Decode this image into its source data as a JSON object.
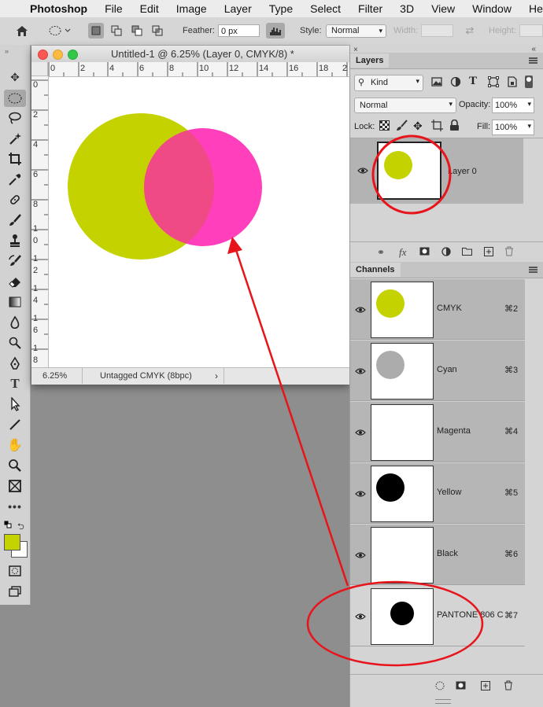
{
  "menubar": {
    "app": "Photoshop",
    "items": [
      "File",
      "Edit",
      "Image",
      "Layer",
      "Type",
      "Select",
      "Filter",
      "3D",
      "View",
      "Window",
      "Help"
    ]
  },
  "options": {
    "feather_label": "Feather:",
    "feather_value": "0 px",
    "style_label": "Style:",
    "style_value": "Normal",
    "width_label": "Width:",
    "height_label": "Height:"
  },
  "document": {
    "title": "Untitled-1 @ 6.25% (Layer 0, CMYK/8) *",
    "ruler_top": [
      "0",
      "2",
      "4",
      "6",
      "8",
      "10",
      "12",
      "14",
      "16",
      "18",
      "2"
    ],
    "ruler_left": [
      "0",
      "2",
      "4",
      "6",
      "8",
      "1",
      "0",
      "1",
      "2",
      "1",
      "4",
      "1",
      "6",
      "1",
      "8"
    ],
    "zoom": "6.25%",
    "profile": "Untagged CMYK (8bpc)",
    "arrow": "›",
    "colors": {
      "olive": "#c4d300",
      "pink": "#ff3fbb",
      "overlap": "#ef4a86"
    }
  },
  "layers_panel": {
    "tab": "Layers",
    "filter": "Kind",
    "blend_mode": "Normal",
    "opacity_label": "Opacity:",
    "opacity_value": "100%",
    "lock_label": "Lock:",
    "fill_label": "Fill:",
    "fill_value": "100%",
    "layers": [
      {
        "name": "Layer 0"
      }
    ],
    "bottom_icons": [
      "link-icon",
      "fx-icon",
      "mask-icon",
      "adjustment-icon",
      "folder-icon",
      "new-layer-icon",
      "trash-icon"
    ]
  },
  "channels_panel": {
    "tab": "Channels",
    "channels": [
      {
        "name": "CMYK",
        "shortcut": "⌘2"
      },
      {
        "name": "Cyan",
        "shortcut": "⌘3"
      },
      {
        "name": "Magenta",
        "shortcut": "⌘4"
      },
      {
        "name": "Yellow",
        "shortcut": "⌘5"
      },
      {
        "name": "Black",
        "shortcut": "⌘6"
      },
      {
        "name": "PANTONE 806 C",
        "shortcut": "⌘7"
      }
    ]
  },
  "annotation_color": "#e8141c",
  "foreground_color": "#c4d300"
}
